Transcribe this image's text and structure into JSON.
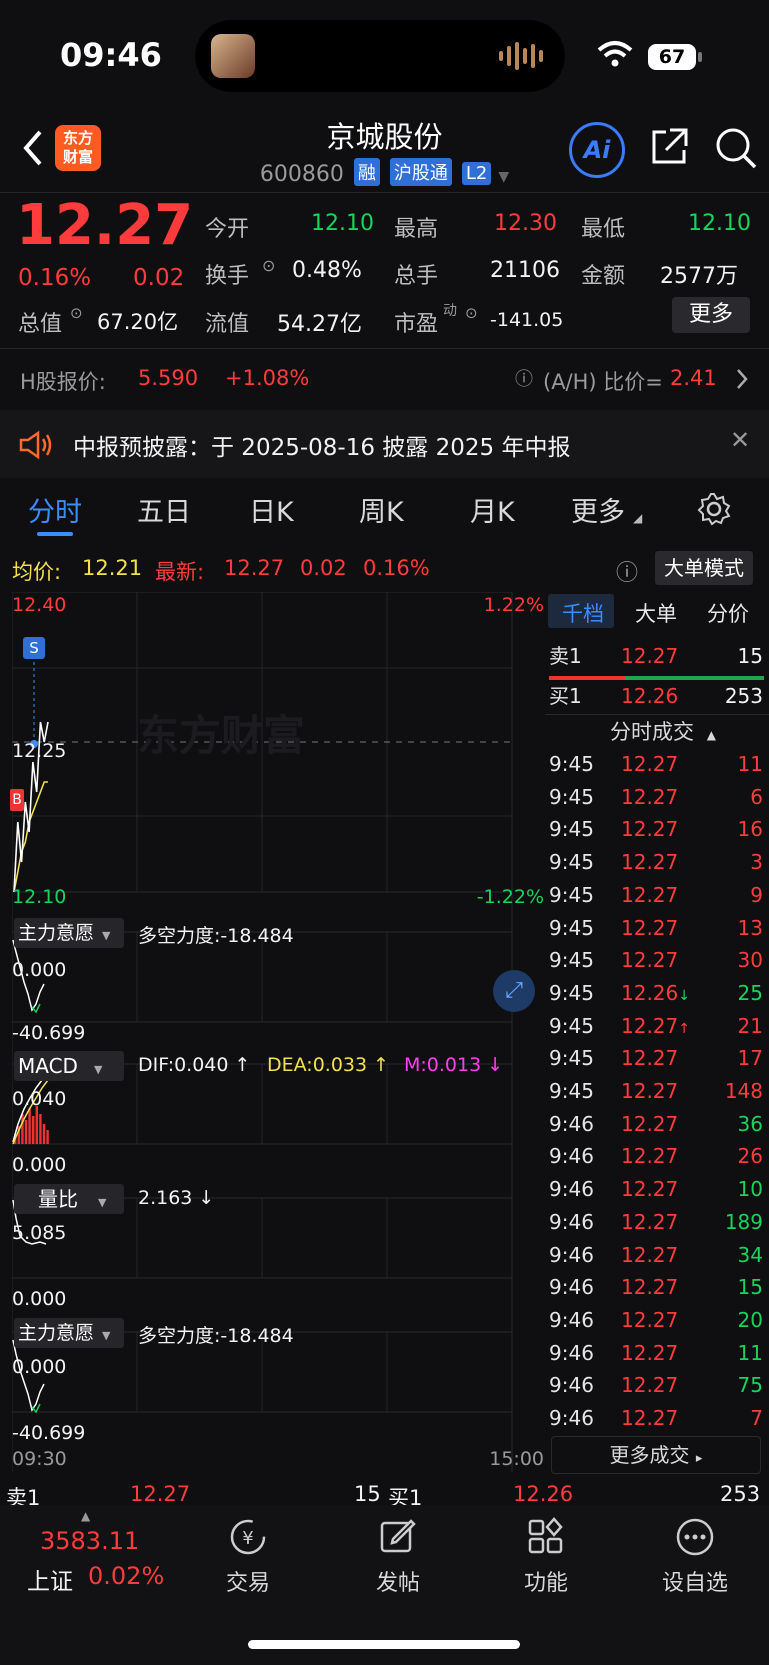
{
  "status_bar": {
    "time": "09:46",
    "battery": "67"
  },
  "header": {
    "back_icon": "chevron-left-icon",
    "logo_text_1": "东方",
    "logo_text_2": "财富",
    "stock_name": "京城股份",
    "stock_code": "600860",
    "tags": [
      "融",
      "沪股通",
      "L2"
    ],
    "ai_label": "Ai",
    "share_icon": "share-icon",
    "search_icon": "search-icon"
  },
  "quote": {
    "price": "12.27",
    "change_pct": "0.16%",
    "change": "0.02",
    "open_label": "今开",
    "open": "12.10",
    "high_label": "最高",
    "high": "12.30",
    "low_label": "最低",
    "low": "12.10",
    "turnover_label": "换手",
    "turnover": "0.48%",
    "volume_label": "总手",
    "volume": "21106",
    "amount_label": "金额",
    "amount": "2577万",
    "mktcap_label": "总值",
    "mktcap": "67.20亿",
    "float_label": "流值",
    "float": "54.27亿",
    "pe_label": "市盈",
    "pe_sup": "动",
    "pe": "-141.05",
    "more_label": "更多"
  },
  "h_share": {
    "label": "H股报价:",
    "price": "5.590",
    "change": "+1.08%",
    "ratio_label": "(A/H) 比价=",
    "ratio": "2.41"
  },
  "notice": {
    "text": "中报预披露：于 2025-08-16 披露 2025 年中报"
  },
  "tabs": [
    "分时",
    "五日",
    "日K",
    "周K",
    "月K",
    "更多"
  ],
  "chart_info": {
    "avg_label": "均价:",
    "avg": "12.21",
    "latest_label": "最新:",
    "latest": "12.27",
    "latest_change": "0.02",
    "latest_pct": "0.16%",
    "mode_label": "大单模式"
  },
  "chart_data": {
    "type": "line",
    "price_axis": {
      "top": "12.40",
      "mid": "12.25",
      "bottom": "12.10",
      "top_pct": "1.22%",
      "bottom_pct": "-1.22%"
    },
    "watermark": "东方财富",
    "marker_S": "S",
    "marker_B": "B",
    "time_start": "09:30",
    "time_end": "15:00",
    "price_series": [
      12.1,
      12.17,
      12.13,
      12.19,
      12.16,
      12.23,
      12.2,
      12.27,
      12.25,
      12.27
    ],
    "avg_series": [
      12.1,
      12.12,
      12.14,
      12.15,
      12.17,
      12.18,
      12.19,
      12.2,
      12.21,
      12.21
    ],
    "indicator1": {
      "name": "主力意愿",
      "label": "多空力度:-18.484",
      "top": "0.000",
      "bottom": "-40.699"
    },
    "macd": {
      "name": "MACD",
      "dif": "DIF:0.040 ↑",
      "dea": "DEA:0.033 ↑",
      "m": "M:0.013 ↓",
      "top": "0.040",
      "bottom": "0.000"
    },
    "volume_ratio": {
      "name": "量比",
      "value": "2.163 ↓",
      "top": "5.085",
      "bottom": "0.000"
    },
    "indicator2": {
      "name": "主力意愿",
      "label": "多空力度:-18.484",
      "top": "0.000",
      "bottom": "-40.699"
    }
  },
  "order_book": {
    "tabs": [
      "千档",
      "大单",
      "分价"
    ],
    "sell1_label": "卖1",
    "sell1_price": "12.27",
    "sell1_vol": "15",
    "buy1_label": "买1",
    "buy1_price": "12.26",
    "buy1_vol": "253",
    "ticks_title": "分时成交",
    "more_trades": "更多成交",
    "ticks": [
      {
        "t": "9:45",
        "p": "12.27",
        "v": "11",
        "c": "red"
      },
      {
        "t": "9:45",
        "p": "12.27",
        "v": "6",
        "c": "red"
      },
      {
        "t": "9:45",
        "p": "12.27",
        "v": "16",
        "c": "red"
      },
      {
        "t": "9:45",
        "p": "12.27",
        "v": "3",
        "c": "red"
      },
      {
        "t": "9:45",
        "p": "12.27",
        "v": "9",
        "c": "red"
      },
      {
        "t": "9:45",
        "p": "12.27",
        "v": "13",
        "c": "red"
      },
      {
        "t": "9:45",
        "p": "12.27",
        "v": "30",
        "c": "red"
      },
      {
        "t": "9:45",
        "p": "12.26↓",
        "v": "25",
        "c": "green"
      },
      {
        "t": "9:45",
        "p": "12.27↑",
        "v": "21",
        "c": "red"
      },
      {
        "t": "9:45",
        "p": "12.27",
        "v": "17",
        "c": "red"
      },
      {
        "t": "9:45",
        "p": "12.27",
        "v": "148",
        "c": "red"
      },
      {
        "t": "9:46",
        "p": "12.27",
        "v": "36",
        "c": "green"
      },
      {
        "t": "9:46",
        "p": "12.27",
        "v": "26",
        "c": "red"
      },
      {
        "t": "9:46",
        "p": "12.27",
        "v": "10",
        "c": "green"
      },
      {
        "t": "9:46",
        "p": "12.27",
        "v": "189",
        "c": "green"
      },
      {
        "t": "9:46",
        "p": "12.27",
        "v": "34",
        "c": "green"
      },
      {
        "t": "9:46",
        "p": "12.27",
        "v": "15",
        "c": "green"
      },
      {
        "t": "9:46",
        "p": "12.27",
        "v": "20",
        "c": "green"
      },
      {
        "t": "9:46",
        "p": "12.27",
        "v": "11",
        "c": "green"
      },
      {
        "t": "9:46",
        "p": "12.27",
        "v": "75",
        "c": "green"
      },
      {
        "t": "9:46",
        "p": "12.27",
        "v": "7",
        "c": "red"
      }
    ]
  },
  "bottom_quote": {
    "sell_label": "卖1",
    "sell_price": "12.27",
    "sell_vol": "15",
    "buy_label": "买1",
    "buy_price": "12.26",
    "buy_vol": "253"
  },
  "bottom_nav": {
    "index_value": "3583.11",
    "index_name": "上证",
    "index_pct": "0.02%",
    "items": [
      "交易",
      "发帖",
      "功能",
      "设自选"
    ]
  },
  "colors": {
    "up": "#ff3b3b",
    "down": "#19d45a",
    "accent": "#3a8cff"
  }
}
